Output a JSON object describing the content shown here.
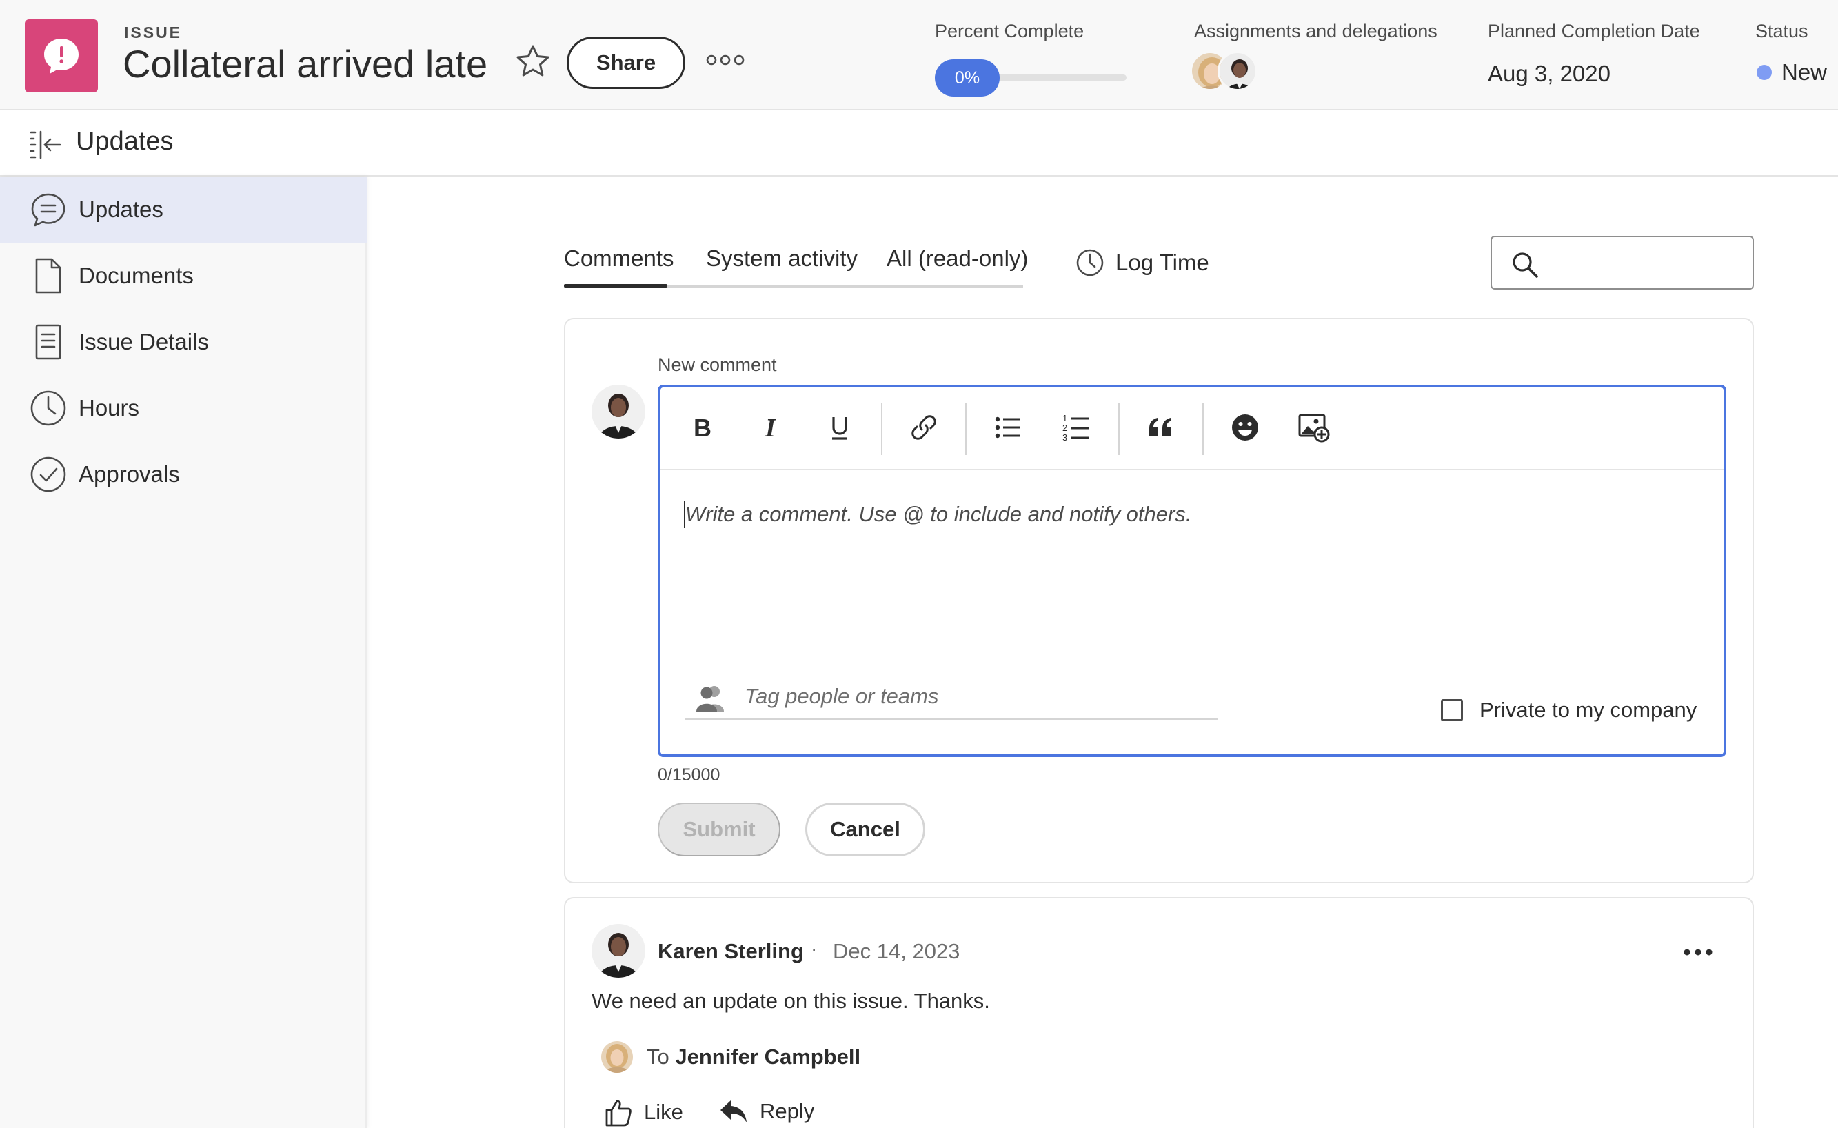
{
  "header": {
    "type_label": "ISSUE",
    "title": "Collateral arrived late",
    "share_label": "Share",
    "percent_complete_label": "Percent Complete",
    "percent_complete_value": "0%",
    "percent_complete": 0,
    "assignments_label": "Assignments and delegations",
    "planned_completion_label": "Planned Completion Date",
    "planned_completion_value": "Aug 3, 2020",
    "status_label": "Status",
    "status_value": "New",
    "status_color": "#7f9cf3"
  },
  "subheader": {
    "title": "Updates"
  },
  "sidebar": {
    "items": [
      {
        "label": "Updates",
        "icon": "chat-bubble-icon",
        "active": true
      },
      {
        "label": "Documents",
        "icon": "document-icon",
        "active": false
      },
      {
        "label": "Issue Details",
        "icon": "details-icon",
        "active": false
      },
      {
        "label": "Hours",
        "icon": "clock-icon",
        "active": false
      },
      {
        "label": "Approvals",
        "icon": "check-circle-icon",
        "active": false
      }
    ]
  },
  "tabs": [
    {
      "label": "Comments",
      "active": true
    },
    {
      "label": "System activity",
      "active": false
    },
    {
      "label": "All (read-only)",
      "active": false
    }
  ],
  "log_time_label": "Log Time",
  "search": {
    "placeholder": "",
    "value": ""
  },
  "new_comment": {
    "label": "New comment",
    "placeholder": "Write a comment. Use @ to include and notify others.",
    "tag_placeholder": "Tag people or teams",
    "private_label": "Private to my company",
    "private_checked": false,
    "char_count": "0/15000",
    "submit_label": "Submit",
    "cancel_label": "Cancel",
    "toolbar": [
      "bold-icon",
      "italic-icon",
      "underline-icon",
      "link-icon",
      "bullet-list-icon",
      "numbered-list-icon",
      "quote-icon",
      "emoji-icon",
      "insert-image-icon"
    ]
  },
  "comment": {
    "author": "Karen Sterling",
    "separator": "·",
    "date": "Dec 14, 2023",
    "body": "We need an update on this issue. Thanks.",
    "to_label": "To",
    "recipient": "Jennifer Campbell",
    "like_label": "Like",
    "reply_label": "Reply"
  },
  "colors": {
    "accent": "#4b75e0",
    "issue_icon": "#d8457a",
    "sidebar_active": "#e6e9f6"
  }
}
